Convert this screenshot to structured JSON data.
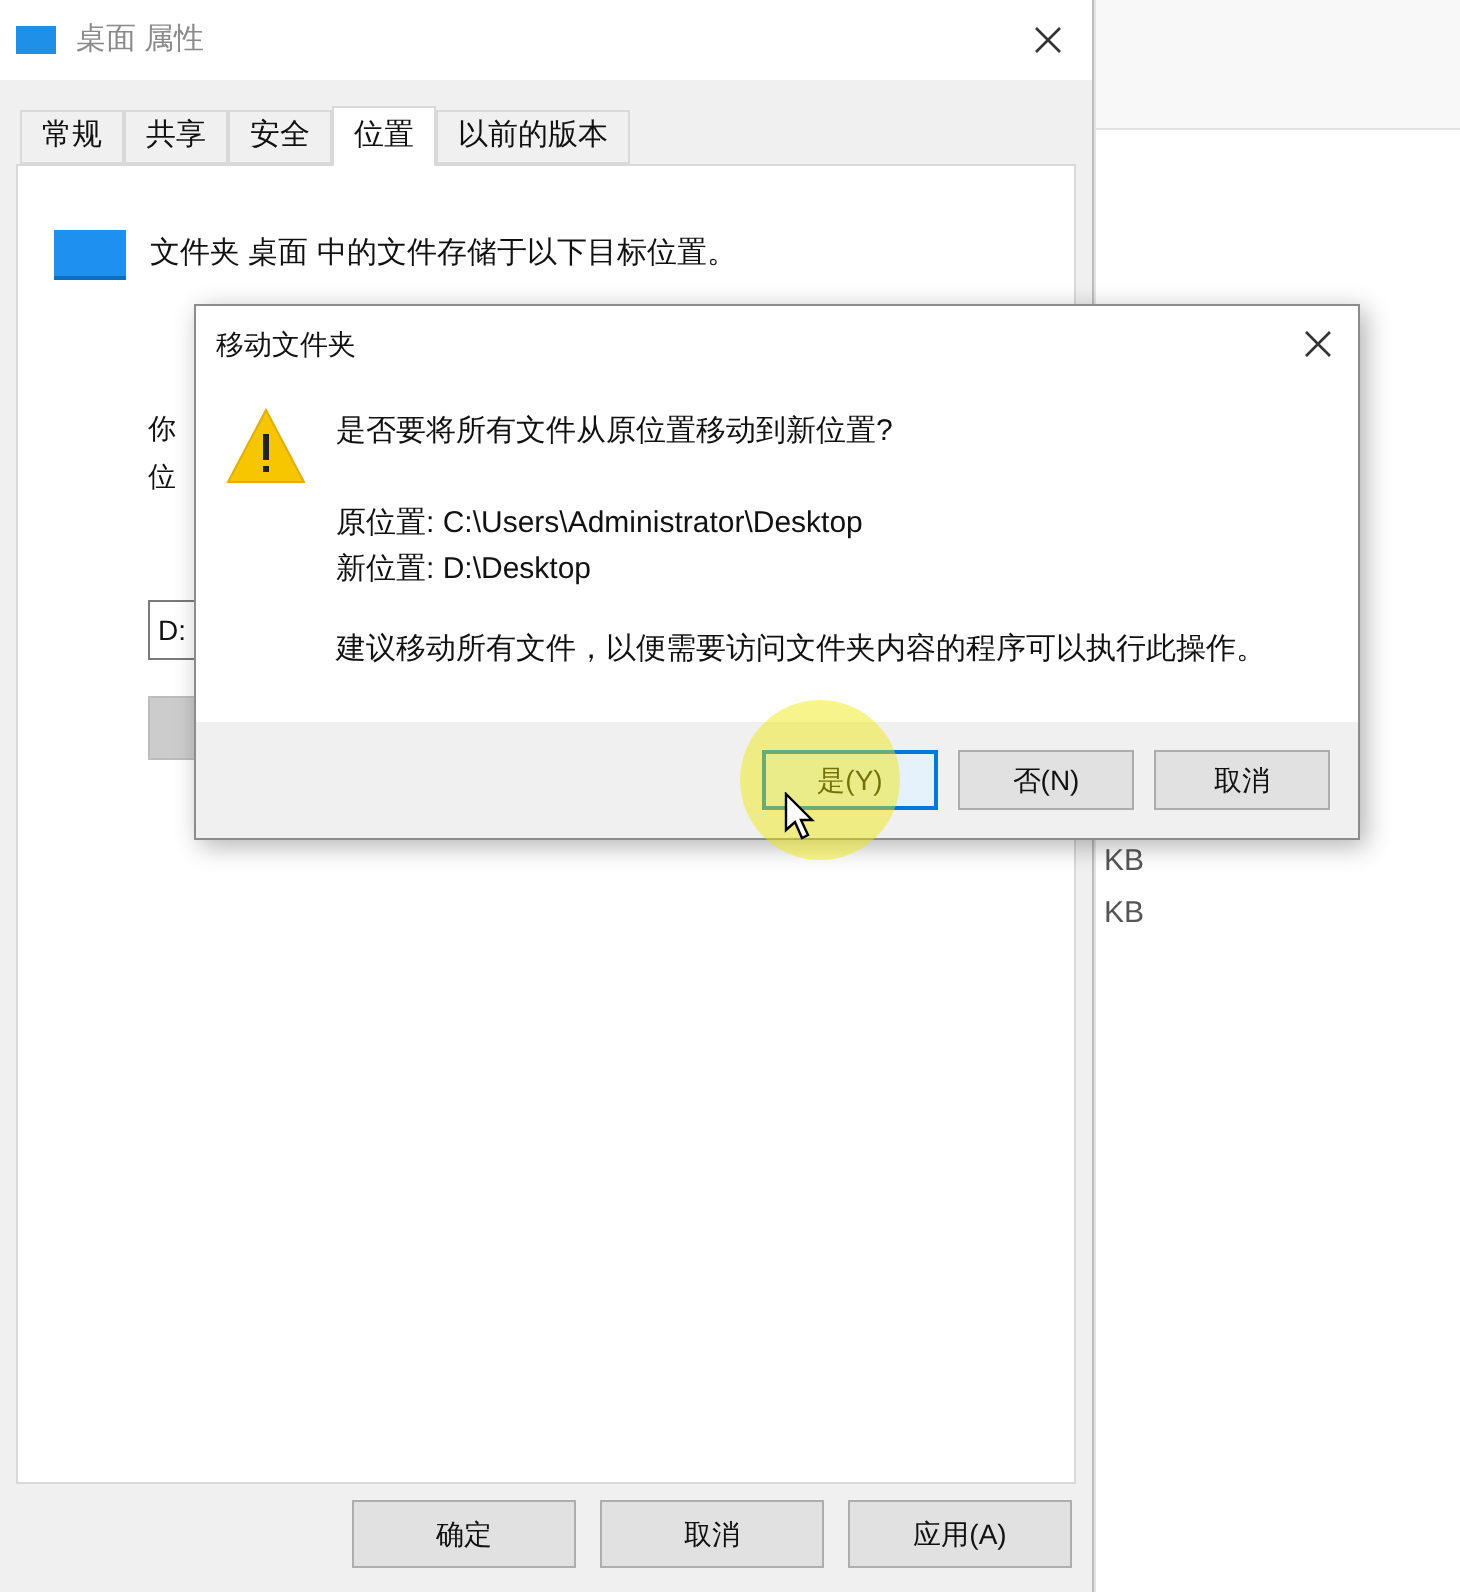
{
  "window": {
    "title": "桌面 属性"
  },
  "tabs": [
    {
      "label": "常规",
      "selected": false
    },
    {
      "label": "共享",
      "selected": false
    },
    {
      "label": "安全",
      "selected": false
    },
    {
      "label": "位置",
      "selected": true
    },
    {
      "label": "以前的版本",
      "selected": false
    }
  ],
  "location_panel": {
    "description": "文件夹 桌面 中的文件存储于以下目标位置。",
    "hint_lines": [
      "你",
      "位"
    ],
    "path_field": {
      "value": "D:"
    }
  },
  "footer_buttons": [
    {
      "label": "确定"
    },
    {
      "label": "取消"
    },
    {
      "label": "应用(A)"
    }
  ],
  "background_window": {
    "sizes": [
      "KB",
      "KB"
    ]
  },
  "dialog": {
    "title": "移动文件夹",
    "question": "是否要将所有文件从原位置移动到新位置?",
    "details": [
      "原位置: C:\\Users\\Administrator\\Desktop",
      "新位置: D:\\Desktop"
    ],
    "advice": "建议移动所有文件，以便需要访问文件夹内容的程序可以执行此操作。",
    "buttons": [
      {
        "label": "是(Y)",
        "selected": true
      },
      {
        "label": "否(N)",
        "selected": false
      },
      {
        "label": "取消",
        "selected": false
      }
    ]
  }
}
